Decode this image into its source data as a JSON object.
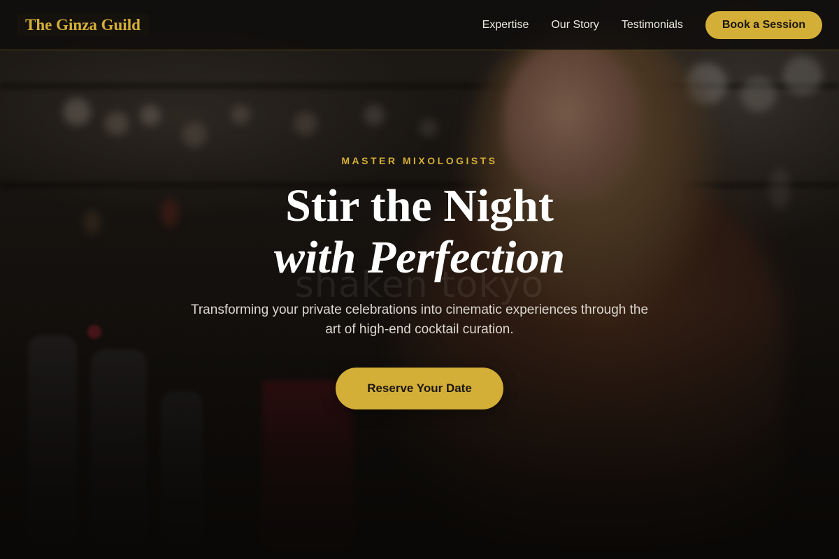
{
  "header": {
    "logo_text": "The Ginza Guild",
    "nav": [
      {
        "label": "Expertise"
      },
      {
        "label": "Our Story"
      },
      {
        "label": "Testimonials"
      }
    ],
    "book_button_label": "Book a Session"
  },
  "hero": {
    "eyebrow": "MASTER MIXOLOGISTS",
    "title_line1": "Stir the Night",
    "title_line2": "with Perfection",
    "watermark": "shaken tokyo",
    "subtitle": "Transforming your private celebrations into cinematic experiences through the art of high-end cocktail curation.",
    "cta_label": "Reserve Your Date"
  },
  "colors": {
    "accent_gold": "#d4af37",
    "background": "#0d0b09",
    "text_light": "#ffffff"
  }
}
